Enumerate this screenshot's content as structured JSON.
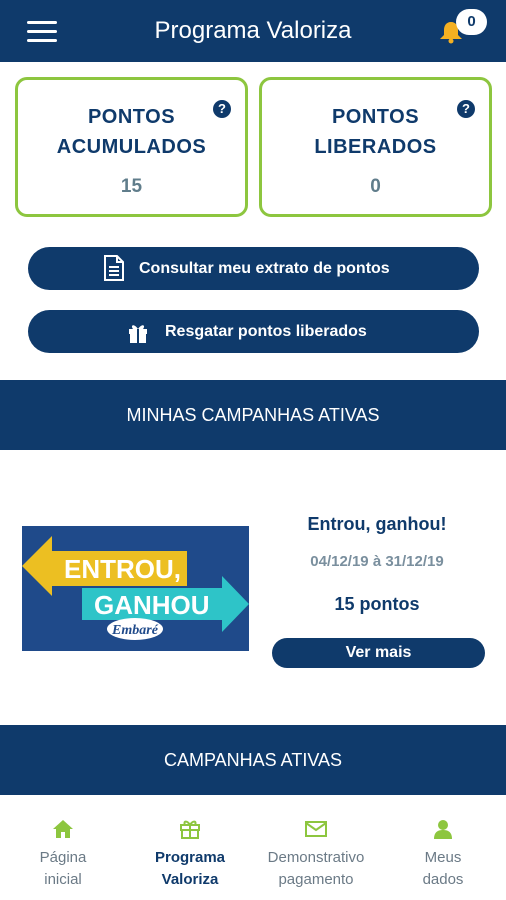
{
  "header": {
    "title": "Programa Valoriza",
    "notification_count": "0",
    "menu_icon": "hamburger-menu-icon",
    "bell_icon": "bell-icon"
  },
  "cards": [
    {
      "title_line1": "PONTOS",
      "title_line2": "ACUMULADOS",
      "value": "15",
      "help_icon": "question-circle-icon"
    },
    {
      "title_line1": "PONTOS",
      "title_line2": "LIBERADOS",
      "value": "0",
      "help_icon": "question-circle-icon"
    }
  ],
  "help_glyph": "?",
  "actions": {
    "statement_label": "Consultar meu extrato de pontos",
    "statement_icon": "document-icon",
    "redeem_label": "Resgatar pontos liberados",
    "redeem_icon": "gift-icon"
  },
  "sections": {
    "my_campaigns": "MINHAS CAMPANHAS ATIVAS",
    "active_campaigns": "CAMPANHAS ATIVAS"
  },
  "campaign": {
    "banner_line1": "ENTROU,",
    "banner_line2": "GANHOU",
    "banner_brand": "Embaré",
    "title": "Entrou, ganhou!",
    "dates": "04/12/19 à 31/12/19",
    "points": "15 pontos",
    "more_label": "Ver mais"
  },
  "bottom_nav": [
    {
      "line1": "Página",
      "line2": "inicial",
      "icon": "home-icon",
      "active": false
    },
    {
      "line1": "Programa",
      "line2": "Valoriza",
      "icon": "gift-icon",
      "active": true
    },
    {
      "line1": "Demonstrativo",
      "line2": "pagamento",
      "icon": "envelope-icon",
      "active": false
    },
    {
      "line1": "Meus",
      "line2": "dados",
      "icon": "user-icon",
      "active": false
    }
  ],
  "colors": {
    "primary": "#0f3a6b",
    "accent_green": "#8dc63f",
    "bell_yellow": "#f5b021",
    "banner_blue": "#1f4a8a",
    "banner_yellow": "#f8c51c",
    "banner_teal": "#2ec4c8"
  }
}
